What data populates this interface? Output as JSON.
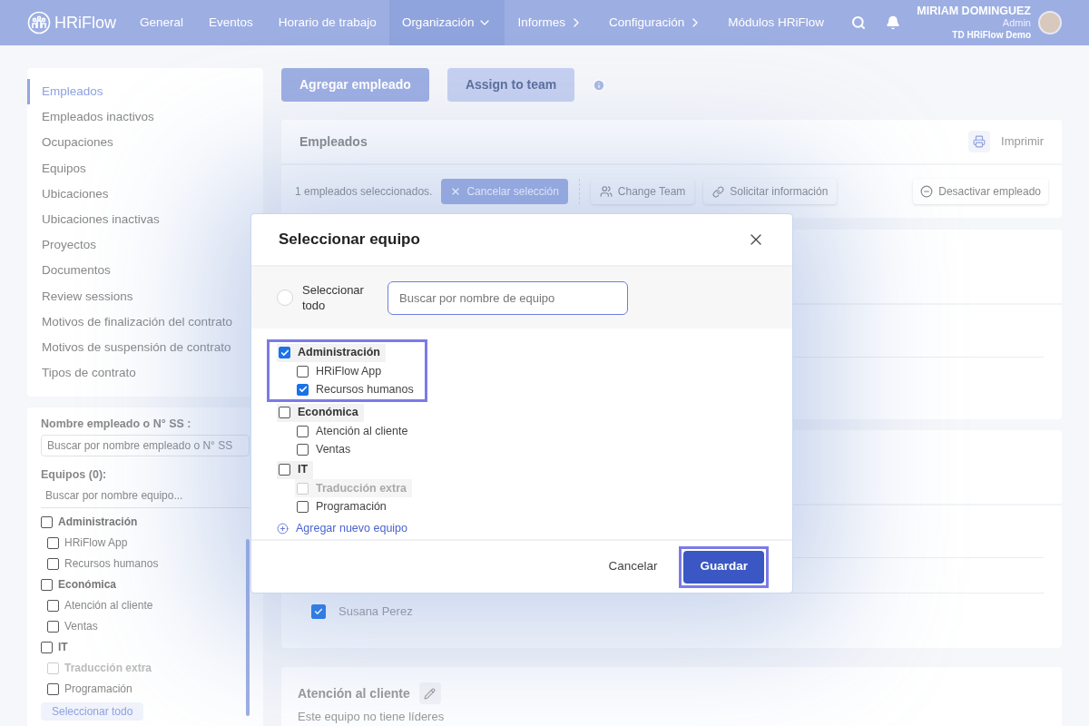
{
  "nav": {
    "logo": "HRiFlow",
    "items": [
      {
        "label": "General",
        "selected": false,
        "kind": "link"
      },
      {
        "label": "Eventos",
        "selected": false,
        "kind": "link"
      },
      {
        "label": "Horario de trabajo",
        "selected": false,
        "kind": "link"
      },
      {
        "label": "Organización",
        "selected": true,
        "kind": "dropdown"
      },
      {
        "label": "Informes",
        "selected": false,
        "kind": "submenu"
      },
      {
        "label": "Configuración",
        "selected": false,
        "kind": "submenu"
      },
      {
        "label": "Módulos HRiFlow",
        "selected": false,
        "kind": "link"
      }
    ],
    "user": {
      "name": "MIRIAM DOMINGUEZ",
      "role": "Admin",
      "company": "TD HRiFlow Demo"
    }
  },
  "sidebar": {
    "items": [
      {
        "label": "Empleados",
        "selected": true
      },
      {
        "label": "Empleados inactivos",
        "selected": false
      },
      {
        "label": "Ocupaciones",
        "selected": false
      },
      {
        "label": "Equipos",
        "selected": false
      },
      {
        "label": "Ubicaciones",
        "selected": false
      },
      {
        "label": "Ubicaciones inactivas",
        "selected": false
      },
      {
        "label": "Proyectos",
        "selected": false
      },
      {
        "label": "Documentos",
        "selected": false
      },
      {
        "label": "Review sessions",
        "selected": false
      },
      {
        "label": "Motivos de finalización del contrato",
        "selected": false
      },
      {
        "label": "Motivos de suspensión de contrato",
        "selected": false
      },
      {
        "label": "Tipos de contrato",
        "selected": false
      }
    ]
  },
  "filter": {
    "name_label": "Nombre empleado o N° SS :",
    "name_placeholder": "Buscar por nombre empleado o N° SS",
    "teams_label": "Equipos (0):",
    "teams_placeholder": "Buscar por nombre equipo...",
    "teams": [
      {
        "label": "Administración",
        "checked": false,
        "disabled": false,
        "children": [
          {
            "label": "HRiFlow App",
            "checked": false,
            "disabled": false
          },
          {
            "label": "Recursos humanos",
            "checked": false,
            "disabled": false
          }
        ]
      },
      {
        "label": "Económica",
        "checked": false,
        "disabled": false,
        "children": [
          {
            "label": "Atención al cliente",
            "checked": false,
            "disabled": false
          },
          {
            "label": "Ventas",
            "checked": false,
            "disabled": false
          }
        ]
      },
      {
        "label": "IT",
        "checked": false,
        "disabled": false,
        "children": [
          {
            "label": "Traducción extra",
            "checked": false,
            "disabled": true
          },
          {
            "label": "Programación",
            "checked": false,
            "disabled": false
          }
        ]
      }
    ],
    "select_all": "Seleccionar todo"
  },
  "actions": {
    "add": {
      "label": "Agregar empleado",
      "disabled": false
    },
    "assign": {
      "label": "Assign to team",
      "disabled": true
    }
  },
  "employees_card": {
    "title": "Empleados",
    "print": "Imprimir",
    "selected_count": "1 empleados seleccionados.",
    "cancel_selection": "Cancelar selección",
    "change_team": "Change Team",
    "request_info": "Solicitar información",
    "deactivate": "Desactivar empleado"
  },
  "members": [
    {
      "name": "Susana Perez",
      "checked": true
    }
  ],
  "team_card": {
    "title": "Atención al cliente",
    "note": "Este equipo no tiene líderes"
  },
  "modal": {
    "title": "Seleccionar equipo",
    "select_all": {
      "label": "Seleccionar todo",
      "checked": false
    },
    "search_placeholder": "Buscar por nombre de equipo",
    "teams": [
      {
        "label": "Administración",
        "checked": true,
        "disabled": false,
        "highlighted": true,
        "children": [
          {
            "label": "HRiFlow App",
            "checked": false,
            "disabled": false
          },
          {
            "label": "Recursos humanos",
            "checked": true,
            "disabled": false
          }
        ]
      },
      {
        "label": "Económica",
        "checked": false,
        "disabled": false,
        "highlighted": false,
        "children": [
          {
            "label": "Atención al cliente",
            "checked": false,
            "disabled": false
          },
          {
            "label": "Ventas",
            "checked": false,
            "disabled": false
          }
        ]
      },
      {
        "label": "IT",
        "checked": false,
        "disabled": false,
        "highlighted": false,
        "children": [
          {
            "label": "Traducción extra",
            "checked": false,
            "disabled": true
          },
          {
            "label": "Programación",
            "checked": false,
            "disabled": false
          }
        ]
      }
    ],
    "add_team": "Agregar nuevo equipo",
    "cancel": "Cancelar",
    "save": {
      "label": "Guardar",
      "highlighted": true
    }
  }
}
